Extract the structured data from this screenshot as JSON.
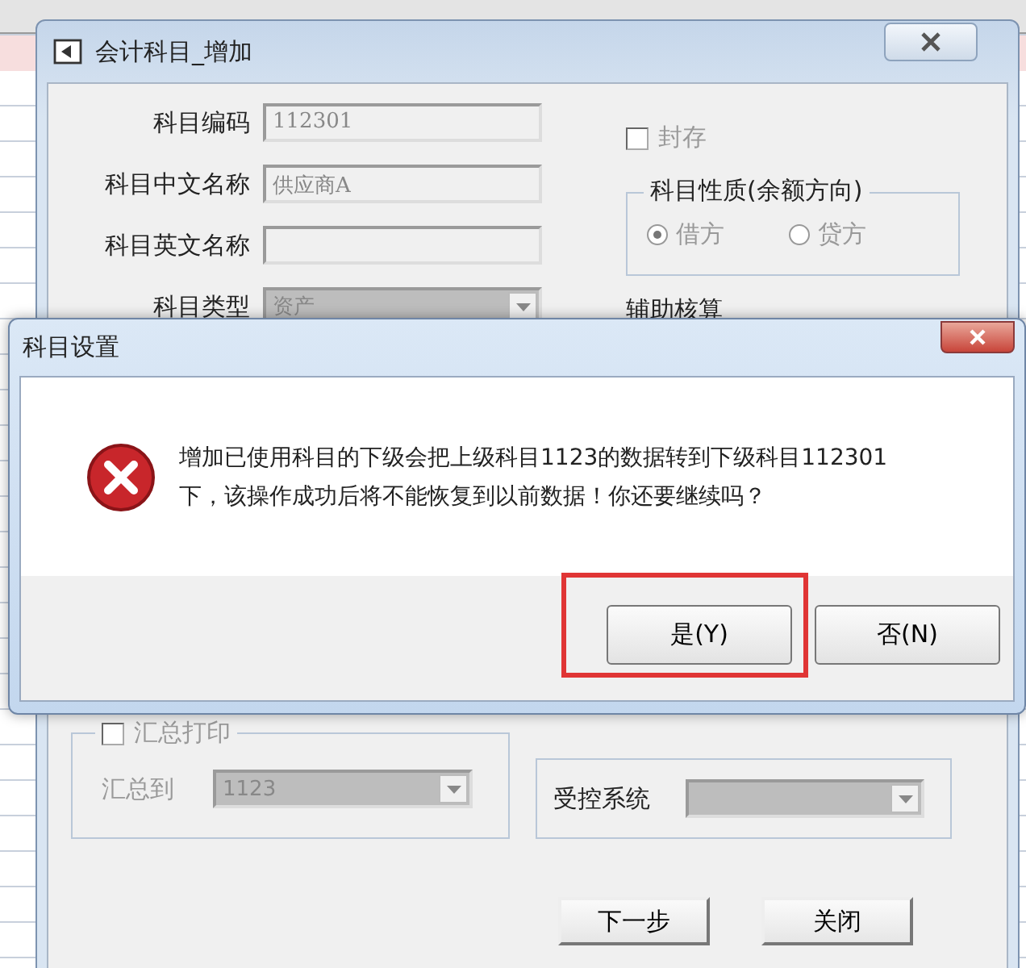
{
  "main_window": {
    "title": "会计科目_增加",
    "fields": [
      {
        "label": "科目编码",
        "value": "112301",
        "kind": "text"
      },
      {
        "label": "科目中文名称",
        "value": "供应商A",
        "kind": "text"
      },
      {
        "label": "科目英文名称",
        "kind": "text"
      },
      {
        "label": "科目类型",
        "value": "资产",
        "kind": "combo"
      }
    ],
    "sealed": {
      "label": "封存",
      "checked": false
    },
    "nature": {
      "title": "科目性质(余额方向)",
      "options": [
        {
          "label": "借方",
          "selected": true
        },
        {
          "label": "贷方",
          "selected": false
        }
      ]
    },
    "auxiliary_title": "辅助核算",
    "summary_print": {
      "label": "汇总打印",
      "checked": false,
      "target_label": "汇总到",
      "target_value": "1123"
    },
    "controlled_system": {
      "label": "受控系统"
    },
    "buttons": [
      "下一步",
      "关闭"
    ]
  },
  "message_dialog": {
    "title": "科目设置",
    "message": "增加已使用科目的下级会把上级科目1123的数据转到下级科目112301\n下，该操作成功后将不能恢复到以前数据！你还要继续吗？",
    "buttons": [
      {
        "label": "是(Y)",
        "highlighted": true
      },
      {
        "label": "否(N)",
        "highlighted": false
      }
    ]
  }
}
